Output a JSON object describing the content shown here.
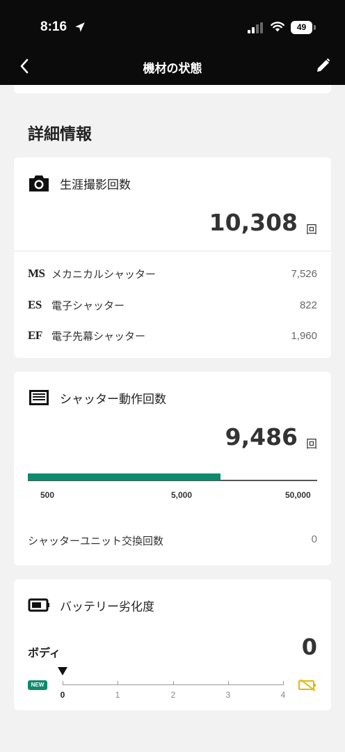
{
  "status_bar": {
    "time": "8:16",
    "battery": "49"
  },
  "nav": {
    "title": "機材の状態"
  },
  "section": {
    "title": "詳細情報"
  },
  "lifetime_card": {
    "label": "生涯撮影回数",
    "value": "10,308",
    "unit": "回",
    "rows": [
      {
        "code": "MS",
        "label": "メカニカルシャッター",
        "value": "7,526"
      },
      {
        "code": "ES",
        "label": "電子シャッター",
        "value": "822"
      },
      {
        "code": "EF",
        "label": "電子先幕シャッター",
        "value": "1,960"
      }
    ]
  },
  "shutter_card": {
    "label": "シャッター動作回数",
    "value": "9,486",
    "unit": "回",
    "bar_fill_fraction": 0.667,
    "ticks": [
      "500",
      "5,000",
      "50,000"
    ],
    "unit_replace_label": "シャッターユニット交換回数",
    "unit_replace_value": "0"
  },
  "battery_card": {
    "label": "バッテリー劣化度",
    "body_label": "ボディ",
    "value": "0",
    "new_badge": "NEW",
    "scale": [
      "0",
      "1",
      "2",
      "3",
      "4"
    ],
    "current_level": 0
  },
  "colors": {
    "accent": "#0e8a6d",
    "warn": "#e6b800",
    "header": "#0b0b0b"
  },
  "icons": [
    "location-arrow-icon",
    "signal-icon",
    "wifi-icon",
    "battery-icon",
    "back-chevron-icon",
    "pencil-icon",
    "camera-icon",
    "shutter-icon",
    "battery-card-icon",
    "battery-warning-icon"
  ]
}
